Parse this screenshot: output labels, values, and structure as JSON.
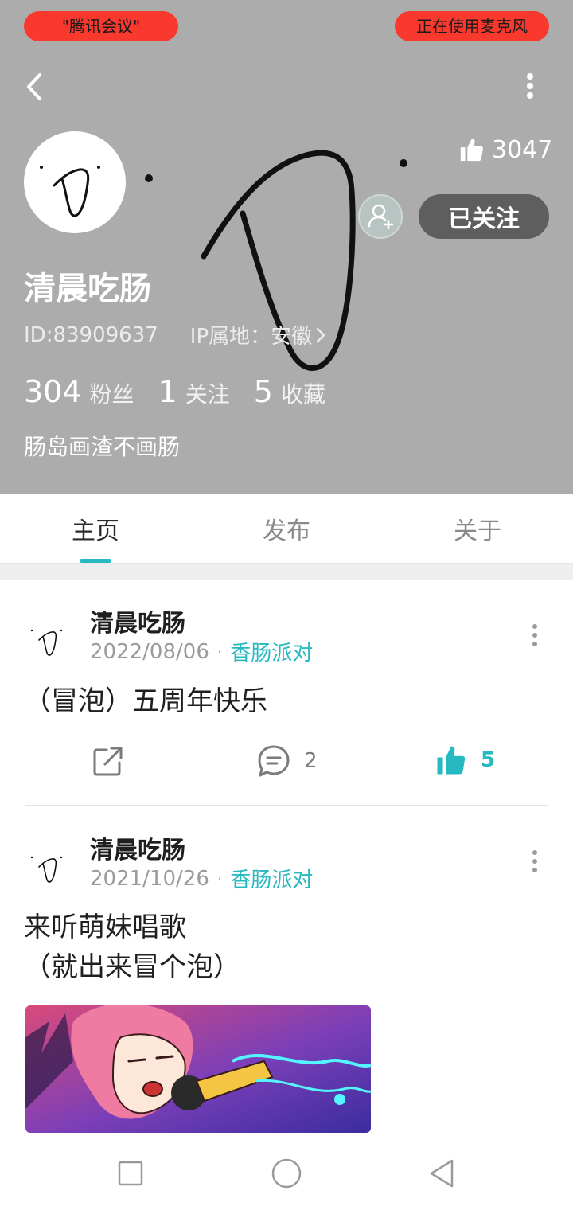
{
  "status": {
    "app_pill": "\"腾讯会议\"",
    "mic_pill": "正在使用麦克风"
  },
  "profile": {
    "likes_count": "3047",
    "follow_label": "已关注",
    "name": "清晨吃肠",
    "id_text": "ID:83909637",
    "ip_text": "IP属地：安徽",
    "stats": [
      {
        "num": "304",
        "label": "粉丝"
      },
      {
        "num": "1",
        "label": "关注"
      },
      {
        "num": "5",
        "label": "收藏"
      }
    ],
    "bio": "肠岛画渣不画肠"
  },
  "tabs": [
    "主页",
    "发布",
    "关于"
  ],
  "posts": [
    {
      "author": "清晨吃肠",
      "date": "2022/08/06",
      "topic": "香肠派对",
      "text": "（冒泡）五周年快乐",
      "comments": "2",
      "likes": "5"
    },
    {
      "author": "清晨吃肠",
      "date": "2021/10/26",
      "topic": "香肠派对",
      "text_line1": "来听萌妹唱歌",
      "text_line2": "（就出来冒个泡）"
    }
  ],
  "colors": {
    "accent": "#27b9c1",
    "header_bg": "#acacac",
    "pill_red": "#f9382e",
    "follow_btn": "#5e5e5e"
  },
  "icons": {
    "back": "chevron-left-icon",
    "more": "more-vertical-icon",
    "like": "thumbs-up-icon",
    "add_friend": "add-user-icon",
    "share": "share-icon",
    "comment": "comment-icon"
  }
}
